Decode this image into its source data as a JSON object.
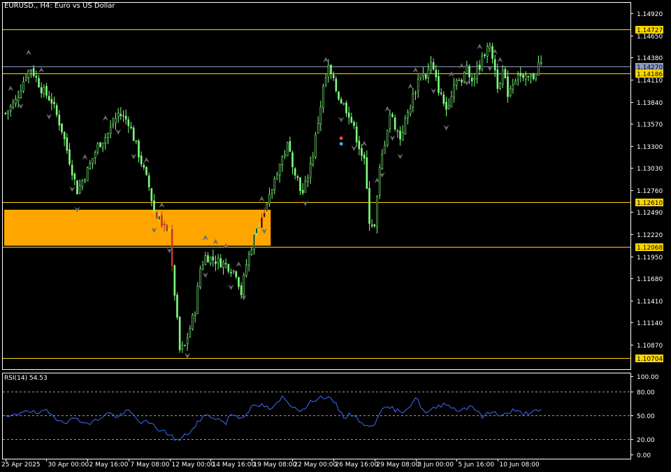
{
  "window": {
    "symbol_title": "EURUSD., H4:  Euro vs US Dollar",
    "rsi_title": "RSI(14) 54.53"
  },
  "colors": {
    "background": "#000000",
    "bull_candle": "#7fff7f",
    "bear_candle": "#7fff7f",
    "resistance_line": "#ffd700",
    "bid_line": "#8c9bc0",
    "zone": "#ffa500",
    "rsi_line": "#3a6cff",
    "rsi_levels": "#9a9a9a",
    "arrow": "#6a6a6a"
  },
  "chart_data": [
    {
      "type": "candlestick",
      "symbol": "EURUSD.",
      "timeframe": "H4",
      "ylim": [
        1.1057,
        1.1505
      ],
      "y_ticks": [
        "1.14920",
        "1.14650",
        "1.14380",
        "1.14110",
        "1.13840",
        "1.13570",
        "1.13300",
        "1.13030",
        "1.12760",
        "1.12490",
        "1.12220",
        "1.11950",
        "1.11680",
        "1.11410",
        "1.11140",
        "1.10870"
      ],
      "x_ticks": [
        "25 Apr 2025",
        "30 Apr 00:00",
        "2 May 16:00",
        "7 May 08:00",
        "12 May 00:00",
        "14 May 16:00",
        "19 May 08:00",
        "22 May 00:00",
        "26 May 16:00",
        "29 May 08:00",
        "3 Jun 00:00",
        "5 Jun 16:00",
        "10 Jun 08:00"
      ],
      "x_tick_index": [
        0,
        16,
        32,
        48,
        64,
        80,
        96,
        112,
        128,
        144,
        160,
        176,
        192
      ],
      "horizontal_levels": [
        {
          "label": "1.14727",
          "value": 1.14727,
          "color": "#ffd700"
        },
        {
          "label": "1.14270",
          "value": 1.1427,
          "color": "#8c9bc0"
        },
        {
          "label": "1.14186",
          "value": 1.14186,
          "color": "#ffd700"
        },
        {
          "label": "1.12610",
          "value": 1.1261,
          "color": "#ffd700"
        },
        {
          "label": "1.12068",
          "value": 1.12068,
          "color": "#ffd700"
        },
        {
          "label": "1.10704",
          "value": 1.10704,
          "color": "#ffd700"
        }
      ],
      "zone": {
        "from_index": 0,
        "to_index": 103,
        "top": 1.1252,
        "bottom": 1.1208
      },
      "close_path": [
        [
          0,
          1.137
        ],
        [
          4,
          1.1385
        ],
        [
          8,
          1.1418
        ],
        [
          10,
          1.1425
        ],
        [
          14,
          1.14
        ],
        [
          18,
          1.1385
        ],
        [
          22,
          1.135
        ],
        [
          26,
          1.13
        ],
        [
          28,
          1.1275
        ],
        [
          32,
          1.13
        ],
        [
          36,
          1.133
        ],
        [
          40,
          1.1345
        ],
        [
          44,
          1.137
        ],
        [
          48,
          1.136
        ],
        [
          52,
          1.132
        ],
        [
          56,
          1.128
        ],
        [
          58,
          1.125
        ],
        [
          62,
          1.123
        ],
        [
          64,
          1.1225
        ],
        [
          66,
          1.115
        ],
        [
          68,
          1.108
        ],
        [
          70,
          1.1085
        ],
        [
          74,
          1.113
        ],
        [
          76,
          1.118
        ],
        [
          78,
          1.1195
        ],
        [
          82,
          1.119
        ],
        [
          86,
          1.1185
        ],
        [
          90,
          1.1175
        ],
        [
          92,
          1.115
        ],
        [
          94,
          1.1185
        ],
        [
          98,
          1.123
        ],
        [
          102,
          1.1255
        ],
        [
          106,
          1.13
        ],
        [
          110,
          1.133
        ],
        [
          114,
          1.129
        ],
        [
          116,
          1.127
        ],
        [
          120,
          1.132
        ],
        [
          124,
          1.14
        ],
        [
          126,
          1.1425
        ],
        [
          130,
          1.139
        ],
        [
          134,
          1.137
        ],
        [
          138,
          1.133
        ],
        [
          140,
          1.131
        ],
        [
          142,
          1.124
        ],
        [
          144,
          1.123
        ],
        [
          146,
          1.13
        ],
        [
          150,
          1.137
        ],
        [
          154,
          1.134
        ],
        [
          158,
          1.138
        ],
        [
          162,
          1.142
        ],
        [
          164,
          1.1415
        ],
        [
          166,
          1.143
        ],
        [
          170,
          1.139
        ],
        [
          172,
          1.1375
        ],
        [
          176,
          1.1415
        ],
        [
          178,
          1.1405
        ],
        [
          180,
          1.143
        ],
        [
          182,
          1.141
        ],
        [
          186,
          1.1435
        ],
        [
          188,
          1.1455
        ],
        [
          190,
          1.144
        ],
        [
          192,
          1.1405
        ],
        [
          194,
          1.142
        ],
        [
          196,
          1.1395
        ],
        [
          200,
          1.142
        ],
        [
          202,
          1.141
        ],
        [
          206,
          1.1415
        ],
        [
          208,
          1.143
        ]
      ],
      "bars": 210,
      "up_arrows_index": [
        2,
        9,
        14,
        31,
        39,
        55,
        61,
        78,
        82,
        86,
        91,
        100,
        125,
        140,
        145,
        149,
        158,
        160,
        174,
        178,
        185,
        191,
        193
      ],
      "down_arrows_index": [
        6,
        17,
        26,
        28,
        44,
        50,
        58,
        64,
        71,
        78,
        88,
        93,
        101,
        117,
        131,
        136,
        147,
        151,
        154,
        167,
        172,
        180,
        189
      ]
    },
    {
      "type": "line",
      "name": "RSI(14)",
      "ylim": [
        0,
        100
      ],
      "y_ticks": [
        "100.00",
        "80.00",
        "50.00",
        "20.00",
        "0.00"
      ],
      "levels": [
        80,
        50,
        20
      ],
      "last_value": "54.53",
      "values_path": [
        [
          0,
          47
        ],
        [
          4,
          50
        ],
        [
          8,
          58
        ],
        [
          12,
          52
        ],
        [
          16,
          55
        ],
        [
          20,
          46
        ],
        [
          24,
          42
        ],
        [
          28,
          47
        ],
        [
          32,
          38
        ],
        [
          36,
          45
        ],
        [
          40,
          53
        ],
        [
          44,
          48
        ],
        [
          48,
          56
        ],
        [
          52,
          43
        ],
        [
          56,
          40
        ],
        [
          60,
          32
        ],
        [
          64,
          26
        ],
        [
          66,
          20
        ],
        [
          68,
          18
        ],
        [
          70,
          24
        ],
        [
          74,
          35
        ],
        [
          76,
          45
        ],
        [
          78,
          50
        ],
        [
          82,
          47
        ],
        [
          86,
          40
        ],
        [
          88,
          52
        ],
        [
          92,
          47
        ],
        [
          96,
          60
        ],
        [
          100,
          63
        ],
        [
          104,
          57
        ],
        [
          108,
          73
        ],
        [
          112,
          62
        ],
        [
          116,
          56
        ],
        [
          120,
          70
        ],
        [
          124,
          74
        ],
        [
          128,
          68
        ],
        [
          132,
          48
        ],
        [
          136,
          52
        ],
        [
          140,
          35
        ],
        [
          144,
          40
        ],
        [
          146,
          55
        ],
        [
          150,
          60
        ],
        [
          154,
          54
        ],
        [
          156,
          58
        ],
        [
          158,
          63
        ],
        [
          160,
          73
        ],
        [
          164,
          52
        ],
        [
          168,
          60
        ],
        [
          172,
          66
        ],
        [
          176,
          56
        ],
        [
          180,
          60
        ],
        [
          182,
          63
        ],
        [
          186,
          48
        ],
        [
          190,
          55
        ],
        [
          194,
          50
        ],
        [
          198,
          56
        ],
        [
          202,
          52
        ],
        [
          206,
          55
        ]
      ]
    }
  ]
}
